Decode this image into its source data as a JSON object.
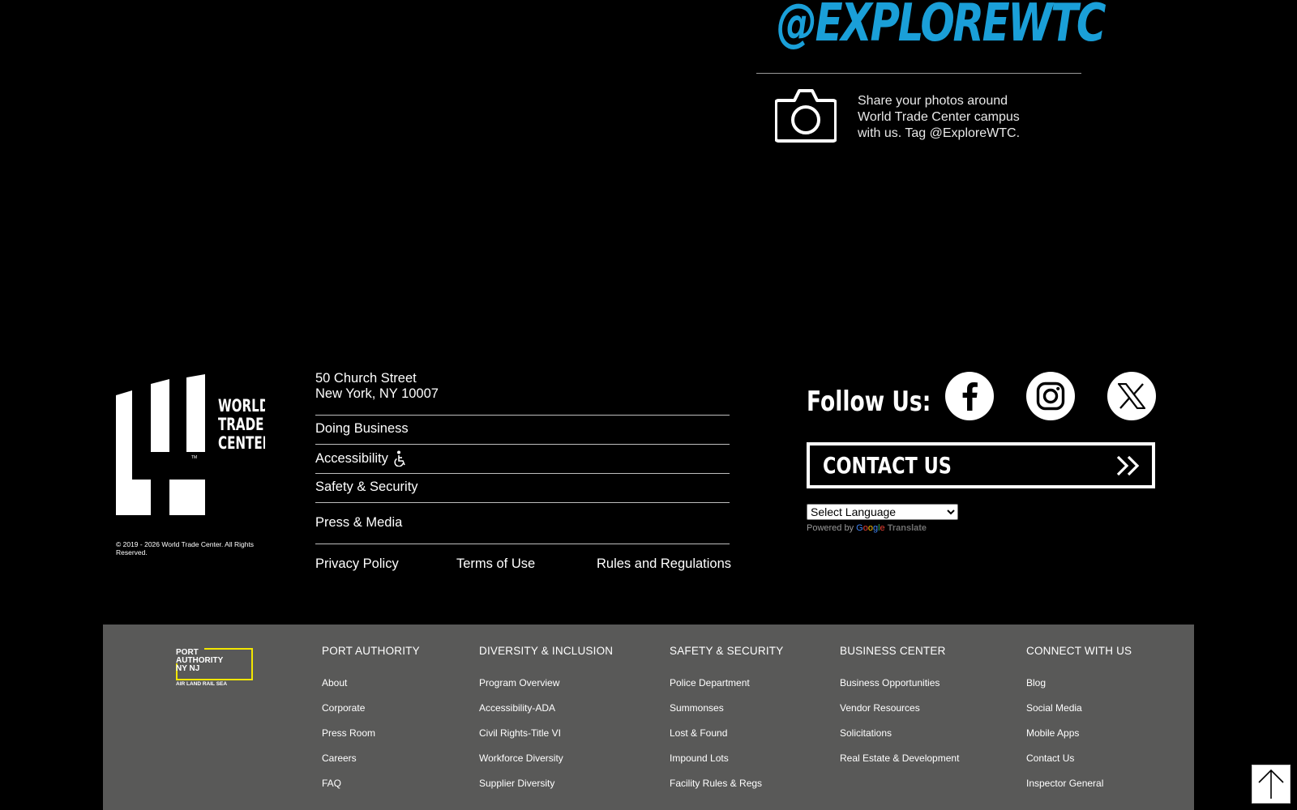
{
  "promo": {
    "handle": "@EXPLOREWTC",
    "text": "Share your photos around World Trade Center campus with us. Tag @ExploreWTC."
  },
  "wtc_logo": {
    "text": "WORLD TRADE CENTER",
    "tm": "TM"
  },
  "copyright": "© 2019 - 2026 World Trade Center. All Rights Reserved.",
  "address": {
    "line1": "50 Church Street",
    "line2": "New York, NY 10007"
  },
  "nav": [
    {
      "label": "Doing Business"
    },
    {
      "label": "Accessibility"
    },
    {
      "label": "Safety & Security"
    },
    {
      "label": "Press & Media"
    }
  ],
  "legal": [
    "Privacy Policy",
    "Terms of Use",
    "Rules and Regulations"
  ],
  "follow": {
    "label": "Follow Us:",
    "icons": [
      "facebook-icon",
      "instagram-icon",
      "x-twitter-icon"
    ]
  },
  "contact": {
    "label": "CONTACT US"
  },
  "language": {
    "selected": "Select Language",
    "powered_by": "Powered by",
    "google": "Google",
    "translate": "Translate"
  },
  "port_authority": {
    "logo_lines": [
      "PORT",
      "AUTHORITY",
      "NY NJ",
      "AIR LAND RAIL SEA"
    ],
    "colors": {
      "accent": "#f2e600",
      "band": "#595958"
    },
    "columns": [
      {
        "heading": "PORT AUTHORITY",
        "links": [
          "About",
          "Corporate",
          "Press Room",
          "Careers",
          "FAQ"
        ]
      },
      {
        "heading": "DIVERSITY & INCLUSION",
        "links": [
          "Program Overview",
          "Accessibility-ADA",
          "Civil Rights-Title VI",
          "Workforce Diversity",
          "Supplier Diversity"
        ]
      },
      {
        "heading": "SAFETY & SECURITY",
        "links": [
          "Police Department",
          "Summonses",
          "Lost & Found",
          "Impound Lots",
          "Facility Rules & Regs"
        ]
      },
      {
        "heading": "BUSINESS CENTER",
        "links": [
          "Business Opportunities",
          "Vendor Resources",
          "Solicitations",
          "Real Estate & Development"
        ]
      },
      {
        "heading": "CONNECT WITH US",
        "links": [
          "Blog",
          "Social Media",
          "Mobile Apps",
          "Contact Us",
          "Inspector General"
        ]
      }
    ]
  },
  "colors": {
    "handle": "#1a9fd8",
    "background": "#000000"
  }
}
